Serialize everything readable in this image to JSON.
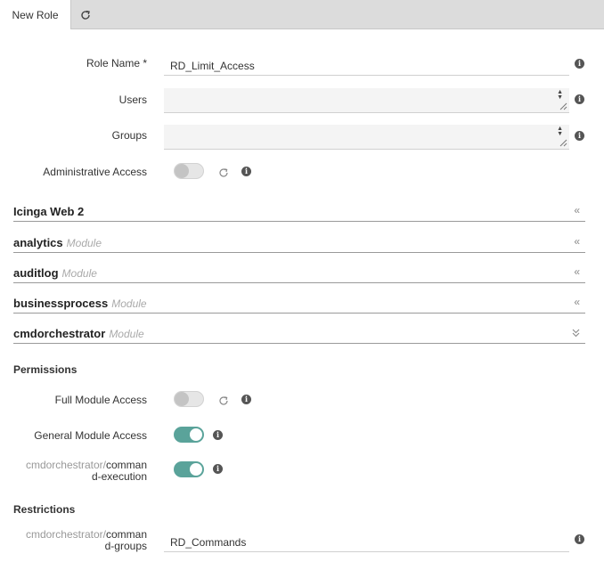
{
  "tabs": [
    {
      "label": "New Role",
      "active": true
    }
  ],
  "form": {
    "role_name": {
      "label": "Role Name *",
      "value": "RD_Limit_Access"
    },
    "users": {
      "label": "Users",
      "value": ""
    },
    "groups": {
      "label": "Groups",
      "value": ""
    },
    "admin_access": {
      "label": "Administrative Access",
      "enabled": false
    }
  },
  "sections": [
    {
      "title": "Icinga Web 2",
      "subtitle": "",
      "expanded": false
    },
    {
      "title": "analytics",
      "subtitle": "Module",
      "expanded": false
    },
    {
      "title": "auditlog",
      "subtitle": "Module",
      "expanded": false
    },
    {
      "title": "businessprocess",
      "subtitle": "Module",
      "expanded": false
    },
    {
      "title": "cmdorchestrator",
      "subtitle": "Module",
      "expanded": true
    }
  ],
  "permissions": {
    "heading": "Permissions",
    "full_module_access": {
      "label": "Full Module Access",
      "enabled": false
    },
    "general_module_access": {
      "label": "General Module Access",
      "enabled": true
    },
    "command_execution": {
      "prefix": "cmdorchestrator/",
      "label_line1": "comman",
      "label_line2": "d-execution",
      "enabled": true
    }
  },
  "restrictions": {
    "heading": "Restrictions",
    "command_groups": {
      "prefix": "cmdorchestrator/",
      "label_line1": "comman",
      "label_line2": "d-groups",
      "value": "RD_Commands"
    }
  },
  "icons": {
    "refresh": "refresh-icon",
    "info": "info-icon",
    "collapse": "double-chevron-left-icon",
    "expand": "double-chevron-down-icon"
  },
  "colors": {
    "toggle_on": "#5aa39a",
    "toggle_off": "#c4c4c4"
  }
}
